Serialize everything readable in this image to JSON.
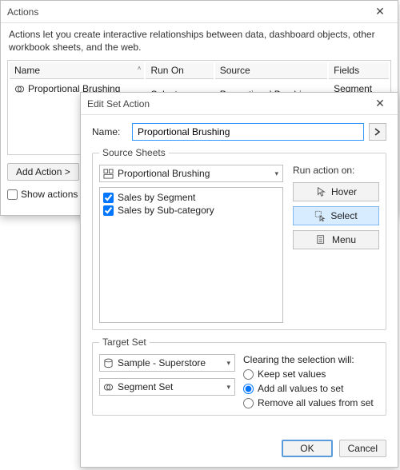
{
  "actions_win": {
    "title": "Actions",
    "description": "Actions let you create interactive relationships between data, dashboard objects, other workbook sheets, and the web.",
    "columns": {
      "name": "Name",
      "run_on": "Run On",
      "source": "Source",
      "fields": "Fields"
    },
    "rows": [
      {
        "name": "Proportional Brushing",
        "run_on": "Select",
        "source": "Proportional Brushing",
        "fields": "Segment Set"
      }
    ],
    "add_action_label": "Add Action >",
    "show_actions_label": "Show actions for"
  },
  "edit_win": {
    "title": "Edit Set Action",
    "name_label": "Name:",
    "name_value": "Proportional Brushing",
    "source_sheets_legend": "Source Sheets",
    "source_dropdown": "Proportional Brushing",
    "sheet_items": [
      {
        "label": "Sales by Segment",
        "checked": true
      },
      {
        "label": "Sales by Sub-category",
        "checked": true
      }
    ],
    "run_label": "Run action on:",
    "run_buttons": {
      "hover": "Hover",
      "select": "Select",
      "menu": "Menu"
    },
    "run_selected": "select",
    "target_legend": "Target Set",
    "target_data_source": "Sample - Superstore",
    "target_set": "Segment Set",
    "clearing_label": "Clearing the selection will:",
    "clearing_options": {
      "keep": "Keep set values",
      "add": "Add all values to set",
      "remove": "Remove all values from set"
    },
    "clearing_selected": "add",
    "ok_label": "OK",
    "cancel_label": "Cancel"
  }
}
